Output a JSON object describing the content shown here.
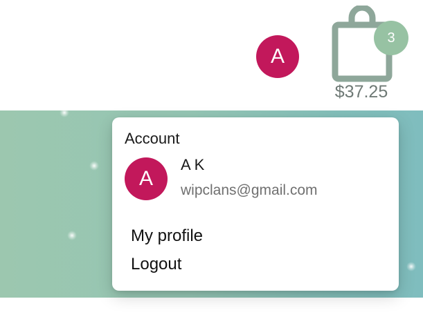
{
  "header": {
    "avatar_initial": "A",
    "cart": {
      "item_count": "3",
      "total": "$37.25",
      "icon": "shopping-bag-icon",
      "badge_color": "#97c2a3",
      "icon_color": "#8ea79a"
    }
  },
  "account_menu": {
    "title": "Account",
    "avatar_initial": "A",
    "user_name": "A K",
    "user_email": "wipclans@gmail.com",
    "items": [
      {
        "label": "My profile"
      },
      {
        "label": "Logout"
      }
    ]
  },
  "colors": {
    "avatar": "#c2185b",
    "banner_start": "#9cc7af",
    "banner_end": "#7fbdbe"
  }
}
